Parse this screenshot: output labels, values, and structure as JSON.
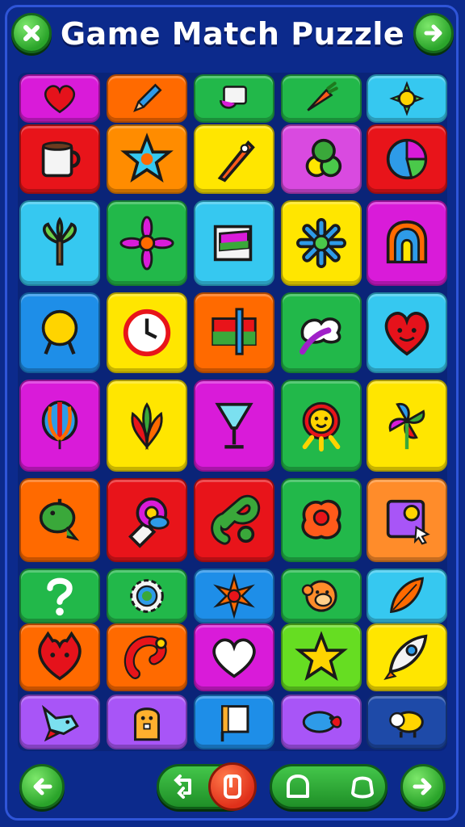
{
  "header": {
    "title": "Game Match Puzzle",
    "close_icon": "close-icon",
    "next_icon": "arrow-right-icon"
  },
  "board": {
    "rows": [
      [
        {
          "icon": "heart",
          "color": "#d91bd9"
        },
        {
          "icon": "pencil",
          "color": "#ff6a00"
        },
        {
          "icon": "ticket",
          "color": "#22b84a"
        },
        {
          "icon": "carrot",
          "color": "#22b84a"
        },
        {
          "icon": "sun",
          "color": "#36c8f0"
        }
      ],
      [
        {
          "icon": "mug",
          "color": "#e8141a"
        },
        {
          "icon": "star",
          "color": "#ff8c00"
        },
        {
          "icon": "rocket",
          "color": "#ffe600"
        },
        {
          "icon": "balls",
          "color": "#d94ae0"
        },
        {
          "icon": "pie",
          "color": "#e8141a"
        }
      ],
      [
        {
          "icon": "tree",
          "color": "#36c8f0"
        },
        {
          "icon": "flower",
          "color": "#22b84a"
        },
        {
          "icon": "book",
          "color": "#36c8f0"
        },
        {
          "icon": "asterisk-flower",
          "color": "#ffe600"
        },
        {
          "icon": "arch",
          "color": "#d91bd9"
        }
      ],
      [
        {
          "icon": "lollipop",
          "color": "#1e8ee8"
        },
        {
          "icon": "clock",
          "color": "#ffe600"
        },
        {
          "icon": "flag",
          "color": "#ff6a00"
        },
        {
          "icon": "cloud-feather",
          "color": "#22b84a"
        },
        {
          "icon": "heart-face",
          "color": "#36c8f0"
        }
      ],
      [
        {
          "icon": "balloon",
          "color": "#d91bd9"
        },
        {
          "icon": "leaves",
          "color": "#ffe600"
        },
        {
          "icon": "glass",
          "color": "#d91bd9"
        },
        {
          "icon": "lion",
          "color": "#22b84a"
        },
        {
          "icon": "pinwheel",
          "color": "#ffe600"
        }
      ],
      [
        {
          "icon": "dino",
          "color": "#ff6a00"
        },
        {
          "icon": "robot",
          "color": "#e8141a"
        },
        {
          "icon": "knot",
          "color": "#e8141a"
        },
        {
          "icon": "blob",
          "color": "#22b84a"
        },
        {
          "icon": "cursor-card",
          "color": "#ff8c2a"
        }
      ],
      [
        {
          "icon": "question",
          "color": "#22b84a"
        },
        {
          "icon": "gear",
          "color": "#22b84a"
        },
        {
          "icon": "flower-orange",
          "color": "#1e8ee8"
        },
        {
          "icon": "monkey",
          "color": "#22b84a"
        },
        {
          "icon": "leaf",
          "color": "#36c8f0"
        }
      ],
      [
        {
          "icon": "cat-heart",
          "color": "#ff6a00"
        },
        {
          "icon": "music-note",
          "color": "#ff6a00"
        },
        {
          "icon": "white-heart",
          "color": "#d91bd9"
        },
        {
          "icon": "star-yellow",
          "color": "#66dd22"
        },
        {
          "icon": "shuttle",
          "color": "#ffe600"
        }
      ],
      [
        {
          "icon": "fox",
          "color": "#a855f7"
        },
        {
          "icon": "hamster",
          "color": "#a855f7"
        },
        {
          "icon": "note-card",
          "color": "#1e8ee8"
        },
        {
          "icon": "fish",
          "color": "#a855f7"
        },
        {
          "icon": "sheep",
          "color": "#1e4aa8"
        }
      ]
    ]
  },
  "bottom_bar": {
    "back_icon": "arrow-left-icon",
    "undo_icon": "undo-icon",
    "hint_icon": "hint-icon",
    "home_icon": "home-icon",
    "restart_icon": "restart-icon",
    "forward_icon": "arrow-right-icon"
  }
}
